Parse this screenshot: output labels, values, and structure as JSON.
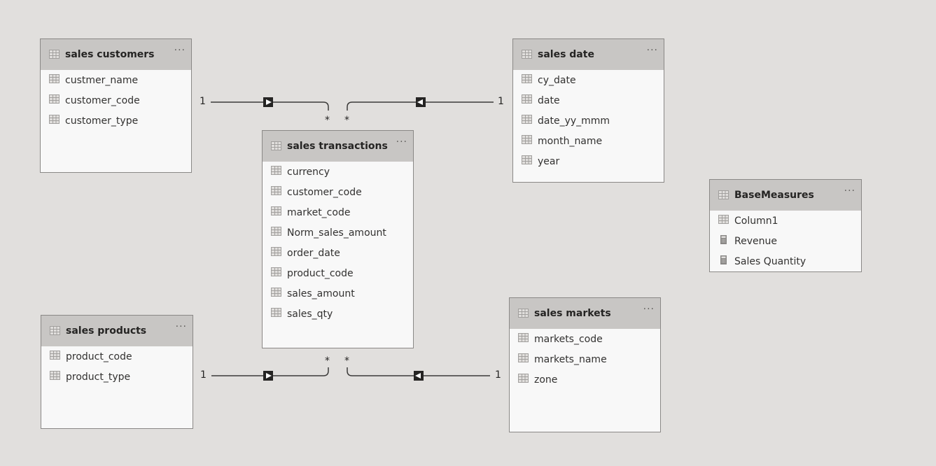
{
  "tables": [
    {
      "id": "customers",
      "title": "sales customers",
      "fields": [
        {
          "name": "custmer_name",
          "icon": "column"
        },
        {
          "name": "customer_code",
          "icon": "column"
        },
        {
          "name": "customer_type",
          "icon": "column"
        }
      ]
    },
    {
      "id": "date",
      "title": "sales date",
      "fields": [
        {
          "name": "cy_date",
          "icon": "column"
        },
        {
          "name": "date",
          "icon": "column"
        },
        {
          "name": "date_yy_mmm",
          "icon": "column"
        },
        {
          "name": "month_name",
          "icon": "column"
        },
        {
          "name": "year",
          "icon": "column"
        }
      ]
    },
    {
      "id": "transactions",
      "title": "sales transactions",
      "fields": [
        {
          "name": "currency",
          "icon": "column"
        },
        {
          "name": "customer_code",
          "icon": "column"
        },
        {
          "name": "market_code",
          "icon": "column"
        },
        {
          "name": "Norm_sales_amount",
          "icon": "column"
        },
        {
          "name": "order_date",
          "icon": "column"
        },
        {
          "name": "product_code",
          "icon": "column"
        },
        {
          "name": "sales_amount",
          "icon": "column"
        },
        {
          "name": "sales_qty",
          "icon": "column"
        }
      ]
    },
    {
      "id": "basemeasures",
      "title": "BaseMeasures",
      "fields": [
        {
          "name": "Column1",
          "icon": "column"
        },
        {
          "name": "Revenue",
          "icon": "measure"
        },
        {
          "name": "Sales Quantity",
          "icon": "measure"
        }
      ]
    },
    {
      "id": "products",
      "title": "sales products",
      "fields": [
        {
          "name": "product_code",
          "icon": "column"
        },
        {
          "name": "product_type",
          "icon": "column"
        }
      ]
    },
    {
      "id": "markets",
      "title": "sales markets",
      "fields": [
        {
          "name": "markets_code",
          "icon": "column"
        },
        {
          "name": "markets_name",
          "icon": "column"
        },
        {
          "name": "zone",
          "icon": "column"
        }
      ]
    }
  ],
  "more_label": "···",
  "relationships": [
    {
      "from": "customers",
      "to": "transactions",
      "one": "1",
      "many": "*"
    },
    {
      "from": "date",
      "to": "transactions",
      "one": "1",
      "many": "*"
    },
    {
      "from": "products",
      "to": "transactions",
      "one": "1",
      "many": "*"
    },
    {
      "from": "markets",
      "to": "transactions",
      "one": "1",
      "many": "*"
    }
  ]
}
